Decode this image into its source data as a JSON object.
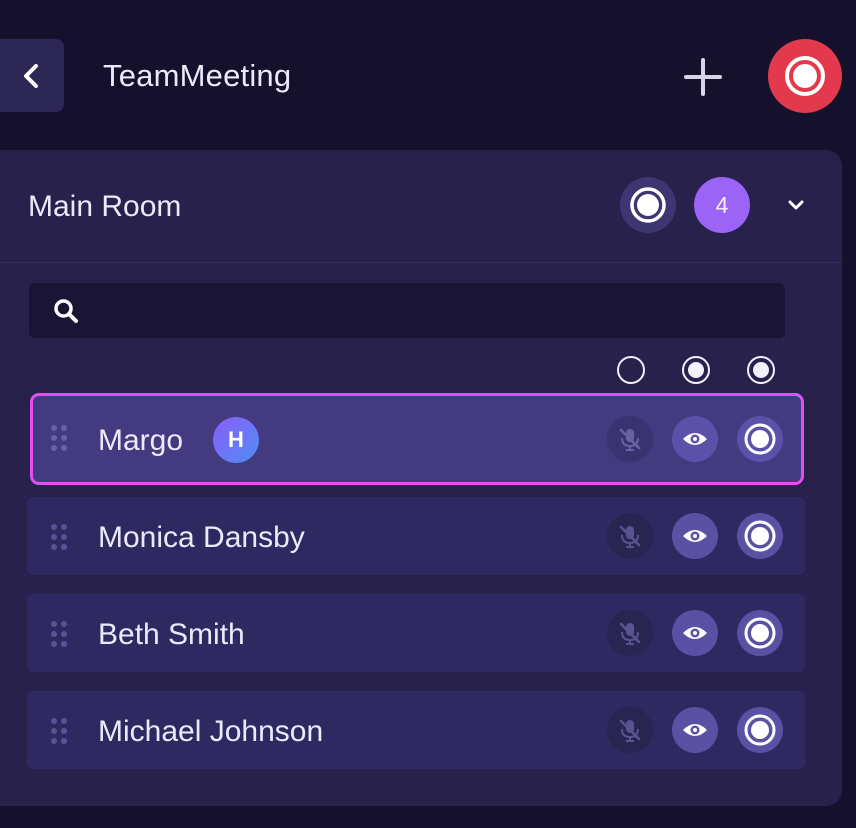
{
  "header": {
    "title": "TeamMeeting"
  },
  "room": {
    "title": "Main Room",
    "participant_count": "4"
  },
  "search": {
    "value": "",
    "placeholder": ""
  },
  "participants": [
    {
      "name": "Margo",
      "badge": "H",
      "selected": true
    },
    {
      "name": "Monica Dansby",
      "selected": false
    },
    {
      "name": "Beth Smith",
      "selected": false
    },
    {
      "name": "Michael Johnson",
      "selected": false
    }
  ],
  "icons": {
    "back": "chevron-left-icon",
    "add": "plus-icon",
    "record": "record-icon",
    "broadcast": "broadcast-icon",
    "expand": "chevron-down-icon",
    "search": "search-icon",
    "drag": "drag-handle-icon",
    "mic": "mic-off-icon",
    "eye": "eye-icon"
  },
  "colors": {
    "background": "#15112d",
    "panel": "#27214c",
    "row": "#2f2962",
    "selected_row": "#433a7f",
    "selection_outline": "#e44ff4",
    "record_red": "#e23a4c",
    "count_purple": "#9b63f6",
    "action_button": "#5a50a4"
  }
}
